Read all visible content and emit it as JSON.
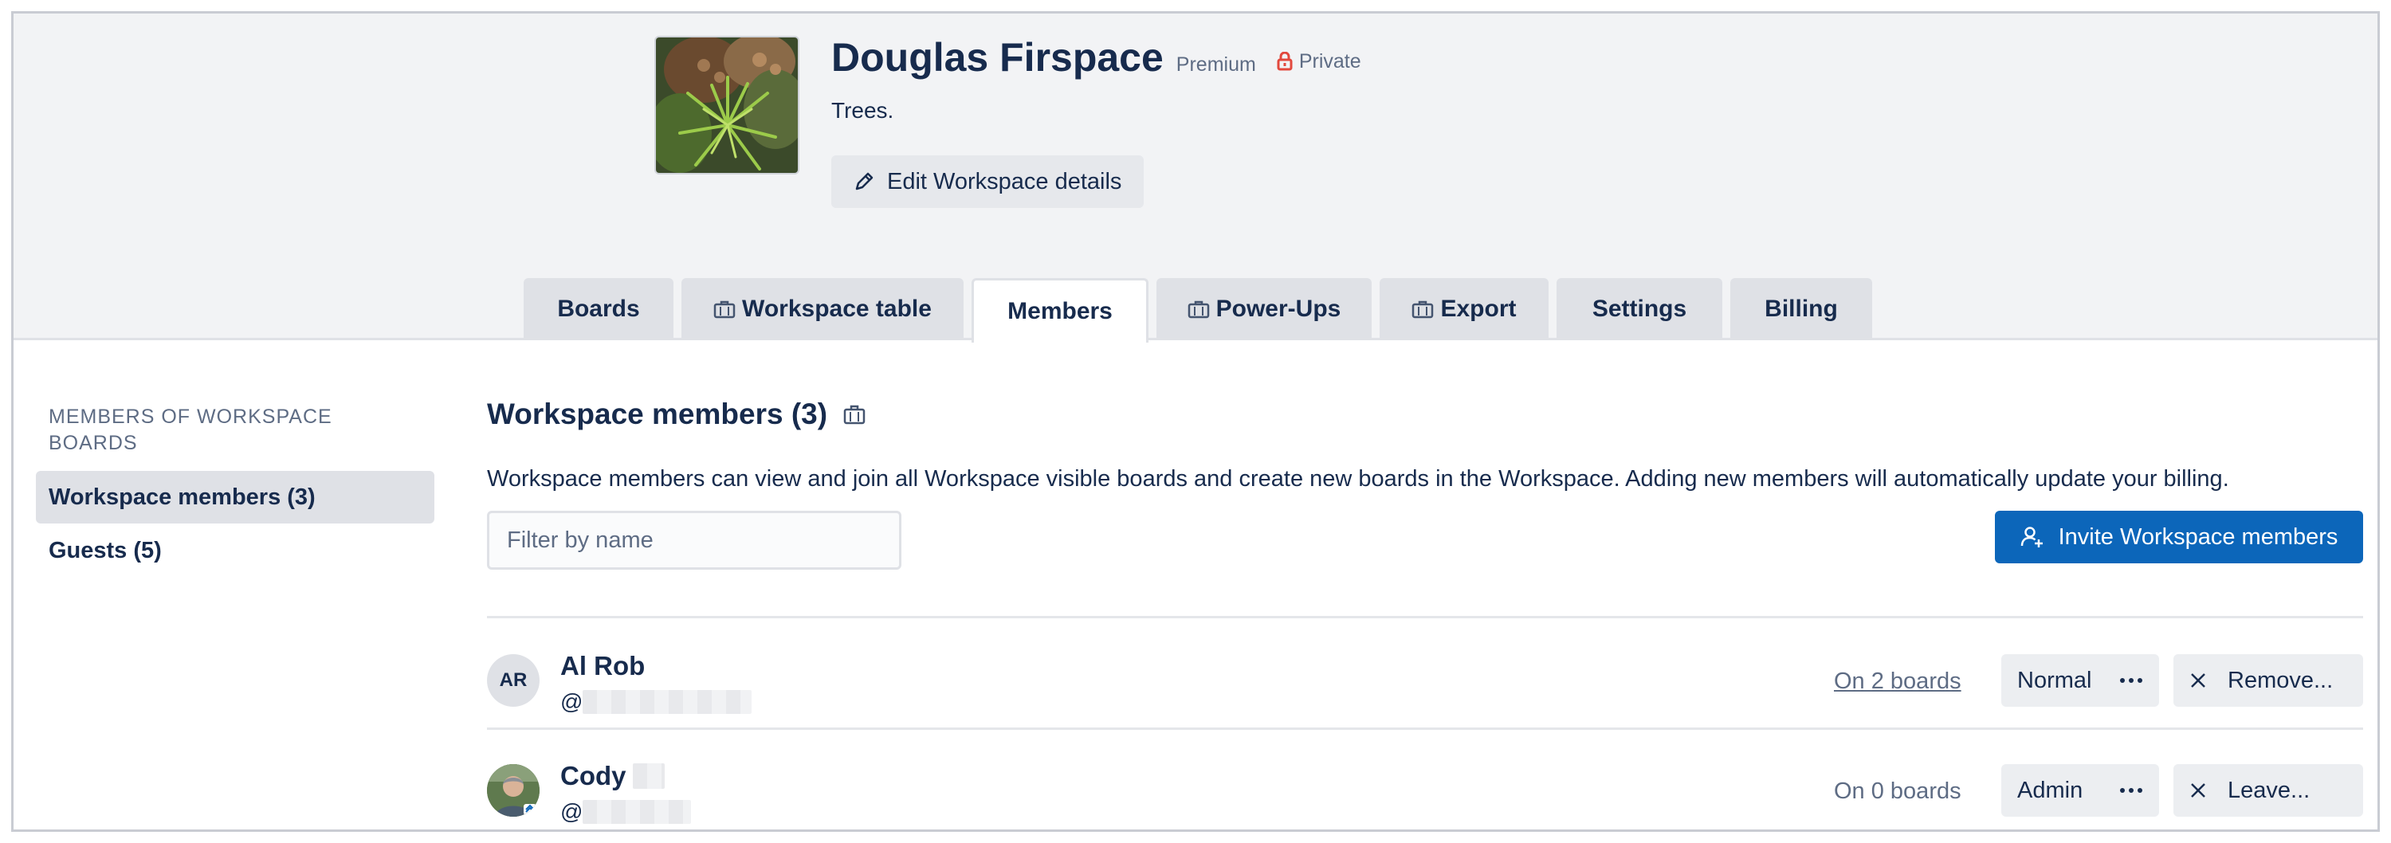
{
  "workspace": {
    "name": "Douglas Firspace",
    "plan_badge": "Premium",
    "visibility": "Private",
    "description": "Trees.",
    "edit_label": "Edit Workspace details"
  },
  "tabs": [
    {
      "label": "Boards",
      "premium_icon": false
    },
    {
      "label": "Workspace table",
      "premium_icon": true
    },
    {
      "label": "Members",
      "premium_icon": false,
      "active": true
    },
    {
      "label": "Power-Ups",
      "premium_icon": true
    },
    {
      "label": "Export",
      "premium_icon": true
    },
    {
      "label": "Settings",
      "premium_icon": false
    },
    {
      "label": "Billing",
      "premium_icon": false
    }
  ],
  "sidebar": {
    "heading": "MEMBERS OF WORKSPACE BOARDS",
    "items": [
      {
        "label": "Workspace members (3)",
        "active": true
      },
      {
        "label": "Guests (5)",
        "active": false
      }
    ]
  },
  "main": {
    "title": "Workspace members (3)",
    "description": "Workspace members can view and join all Workspace visible boards and create new boards in the Workspace. Adding new members will automatically update your billing.",
    "filter_placeholder": "Filter by name",
    "invite_label": "Invite Workspace members"
  },
  "members": [
    {
      "initials": "AR",
      "name": "Al Rob",
      "handle_prefix": "@",
      "boards": "On 2 boards",
      "role": "Normal",
      "action": "Remove..."
    },
    {
      "initials": "",
      "name": "Cody",
      "handle_prefix": "@",
      "boards": "On 0 boards",
      "role": "Admin",
      "action": "Leave..."
    }
  ],
  "colors": {
    "accent": "#0c66ba",
    "private_icon": "#e2483d",
    "header_bg": "#f2f3f5"
  }
}
